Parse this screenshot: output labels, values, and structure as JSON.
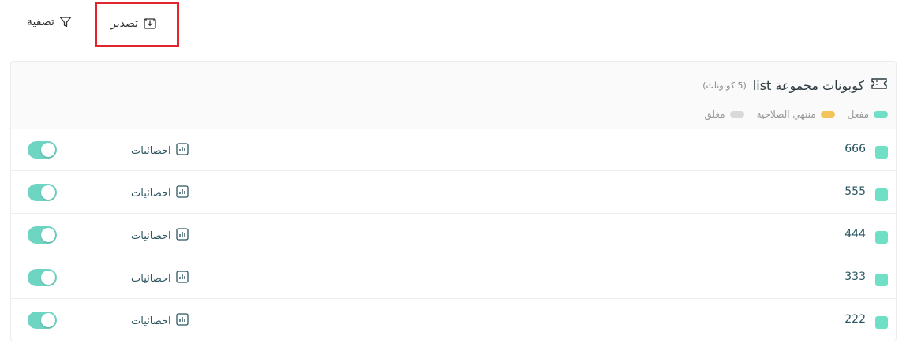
{
  "toolbar": {
    "filter_label": "تصفية",
    "export_label": "تصدير"
  },
  "card": {
    "title": "كوبونات مجموعة list",
    "count": "(5 كوبونات)",
    "legend": [
      {
        "label": "مفعل",
        "color": "#6fe0c5"
      },
      {
        "label": "منتهي الصلاحية",
        "color": "#f3c45a"
      },
      {
        "label": "مغلق",
        "color": "#d9d9d9"
      }
    ]
  },
  "coupons": [
    {
      "name": "666",
      "status_color": "#6fe0c5",
      "stats_label": "احصائيات",
      "enabled": true
    },
    {
      "name": "555",
      "status_color": "#6fe0c5",
      "stats_label": "احصائيات",
      "enabled": true
    },
    {
      "name": "444",
      "status_color": "#6fe0c5",
      "stats_label": "احصائيات",
      "enabled": true
    },
    {
      "name": "333",
      "status_color": "#6fe0c5",
      "stats_label": "احصائيات",
      "enabled": true
    },
    {
      "name": "222",
      "status_color": "#6fe0c5",
      "stats_label": "احصائيات",
      "enabled": true
    }
  ],
  "colors": {
    "highlight": "#e0252c",
    "toggle_on": "#6fd5c3",
    "accent_text": "#2b5560"
  }
}
